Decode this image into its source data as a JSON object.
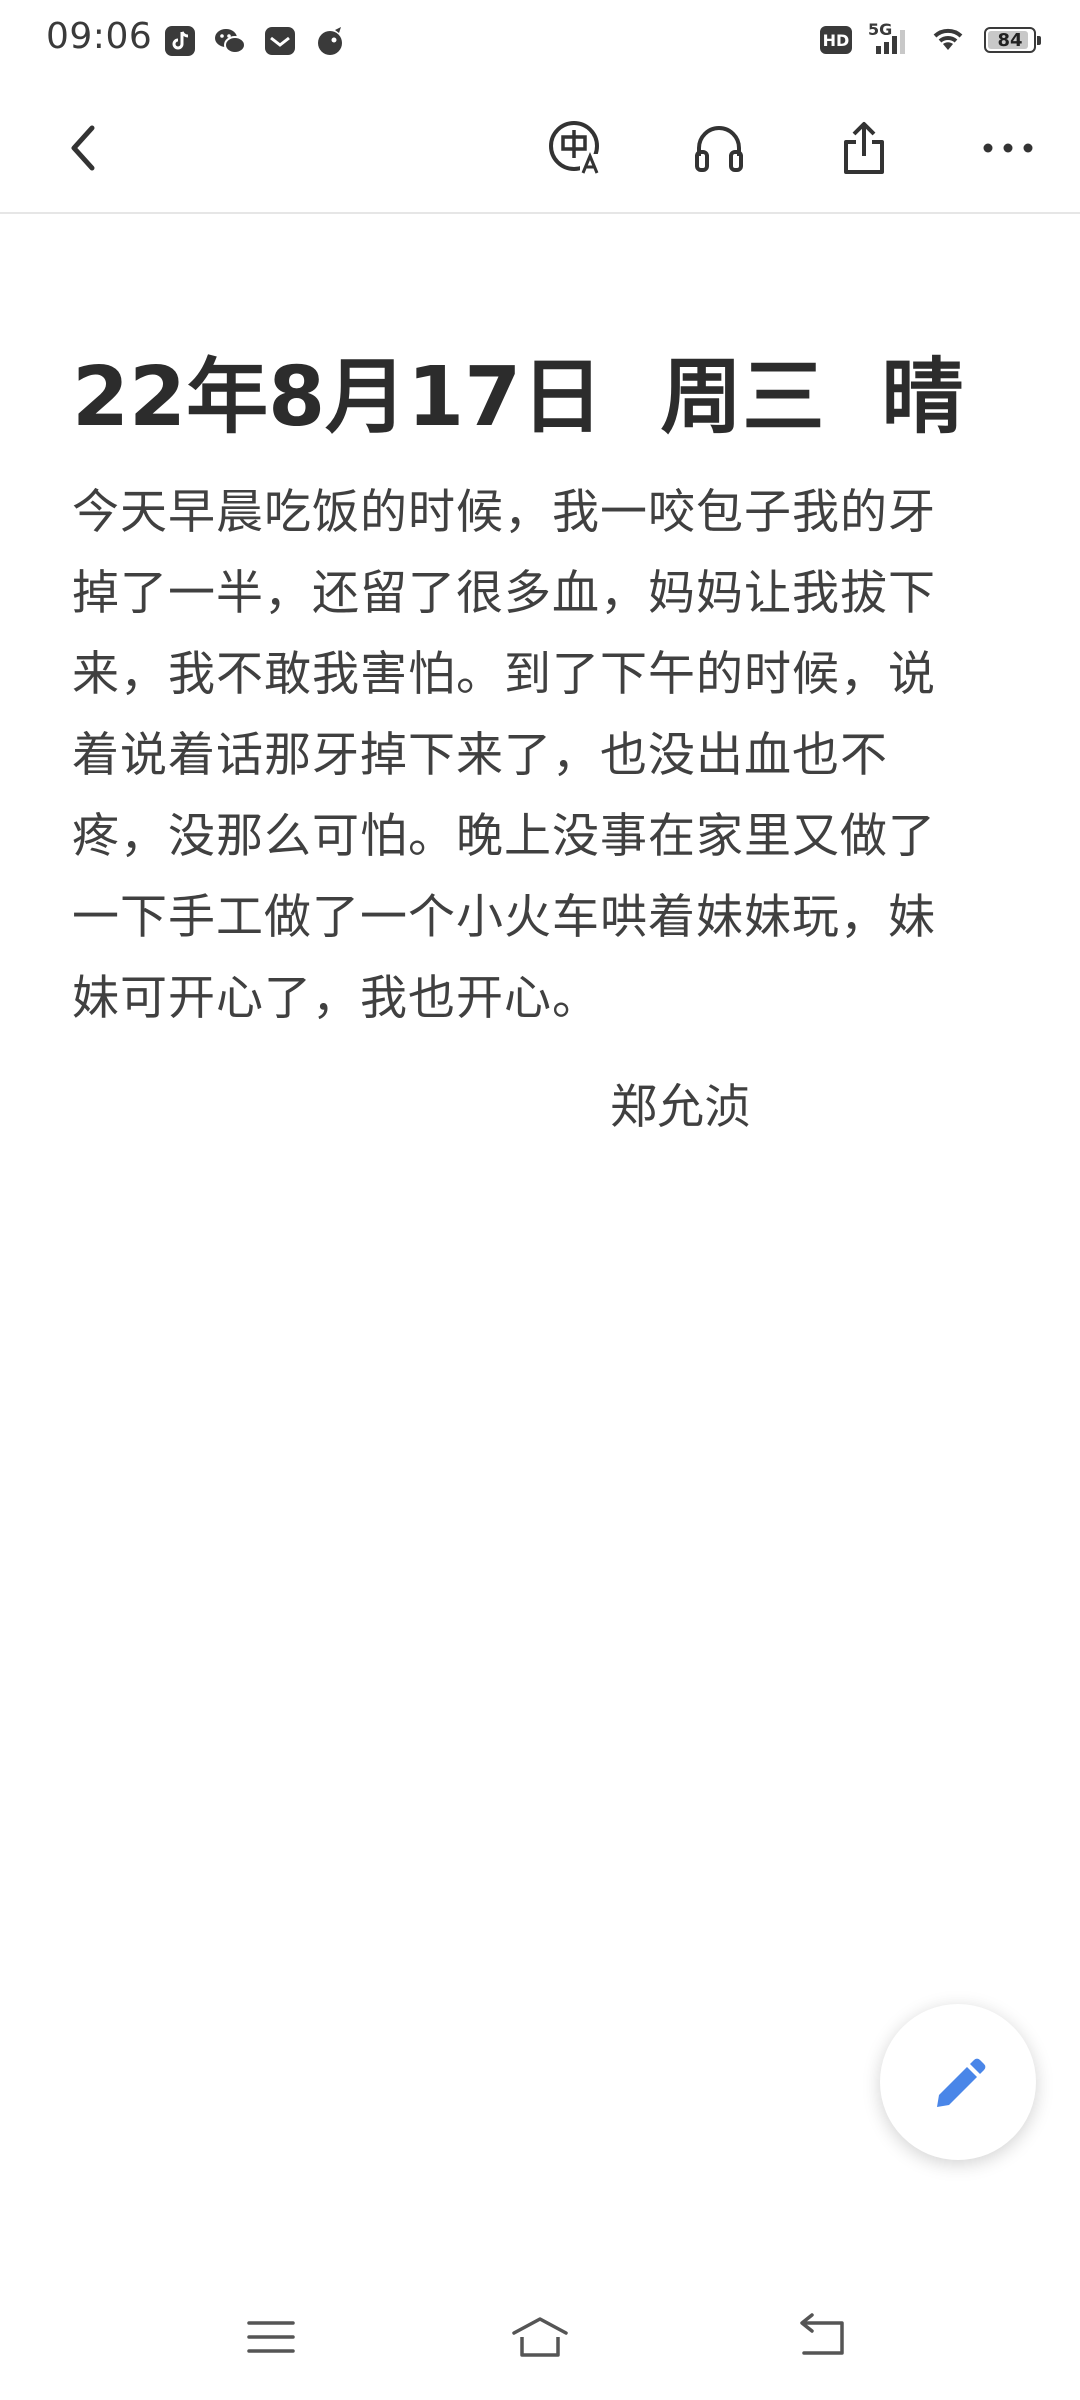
{
  "status_bar": {
    "time": "09:06",
    "left_icons": [
      "tiktok-icon",
      "wechat-icon",
      "mail-app-icon",
      "bird-app-icon"
    ],
    "network_badge": "HD",
    "network_type": "5G",
    "battery_level": "84"
  },
  "toolbar": {
    "back_icon": "chevron-left-icon",
    "translate_icon": "translate-icon",
    "audio_icon": "headphones-icon",
    "share_icon": "share-icon",
    "more_icon": "more-icon"
  },
  "note": {
    "title": "22年8月17日  周三  晴",
    "body": "今天早晨吃饭的时候，我一咬包子我的牙掉了一半，还留了很多血，妈妈让我拔下来，我不敢我害怕。到了下午的时候，说着说着话那牙掉下来了，也没出血也不疼，没那么可怕。晚上没事在家里又做了一下手工做了一个小火车哄着妹妹玩，妹妹可开心了，我也开心。",
    "signature": "郑允浈"
  },
  "fab": {
    "icon": "pencil-icon",
    "accent_color": "#4a86e8"
  },
  "nav_bar": {
    "menu_icon": "menu-icon",
    "home_icon": "home-icon",
    "back_icon": "back-arrow-icon"
  }
}
